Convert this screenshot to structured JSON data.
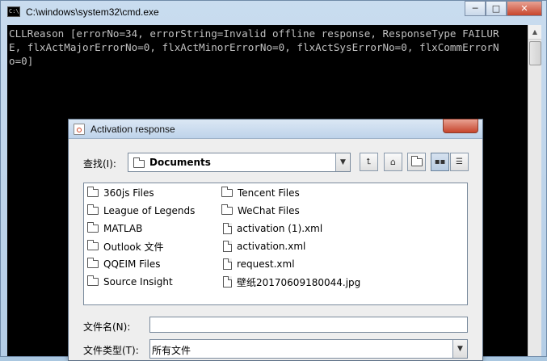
{
  "cmd": {
    "title": "C:\\windows\\system32\\cmd.exe",
    "icon_text": "C:\\",
    "console_lines": [
      "CLLReason [errorNo=34, errorString=Invalid offline response, ResponseType FAILUR",
      "E, flxActMajorErrorNo=0, flxActMinorErrorNo=0, flxActSysErrorNo=0, flxCommErrorN",
      "o=0]"
    ],
    "buttons": {
      "minimize": "─",
      "maximize": "□",
      "close": "✕"
    }
  },
  "dialog": {
    "title": "Activation response",
    "look_in_label": "查找(I):",
    "look_in_value": "Documents",
    "files_col1": [
      {
        "name": "360js Files",
        "icon": "folder-icon"
      },
      {
        "name": "League of Legends",
        "icon": "folder-icon"
      },
      {
        "name": "MATLAB",
        "icon": "folder-icon"
      },
      {
        "name": "Outlook 文件",
        "icon": "folder-icon"
      },
      {
        "name": "QQEIM Files",
        "icon": "folder-icon"
      },
      {
        "name": "Source Insight",
        "icon": "folder-icon"
      }
    ],
    "files_col2": [
      {
        "name": "Tencent Files",
        "icon": "folder-icon"
      },
      {
        "name": "WeChat Files",
        "icon": "folder-icon"
      },
      {
        "name": "activation (1).xml",
        "icon": "file-icon"
      },
      {
        "name": "activation.xml",
        "icon": "file-icon"
      },
      {
        "name": "request.xml",
        "icon": "file-icon"
      },
      {
        "name": "壁纸20170609180044.jpg",
        "icon": "file-icon"
      }
    ],
    "filename_label": "文件名(N):",
    "filename_value": "",
    "filetype_label": "文件类型(T):",
    "filetype_value": "所有文件"
  }
}
